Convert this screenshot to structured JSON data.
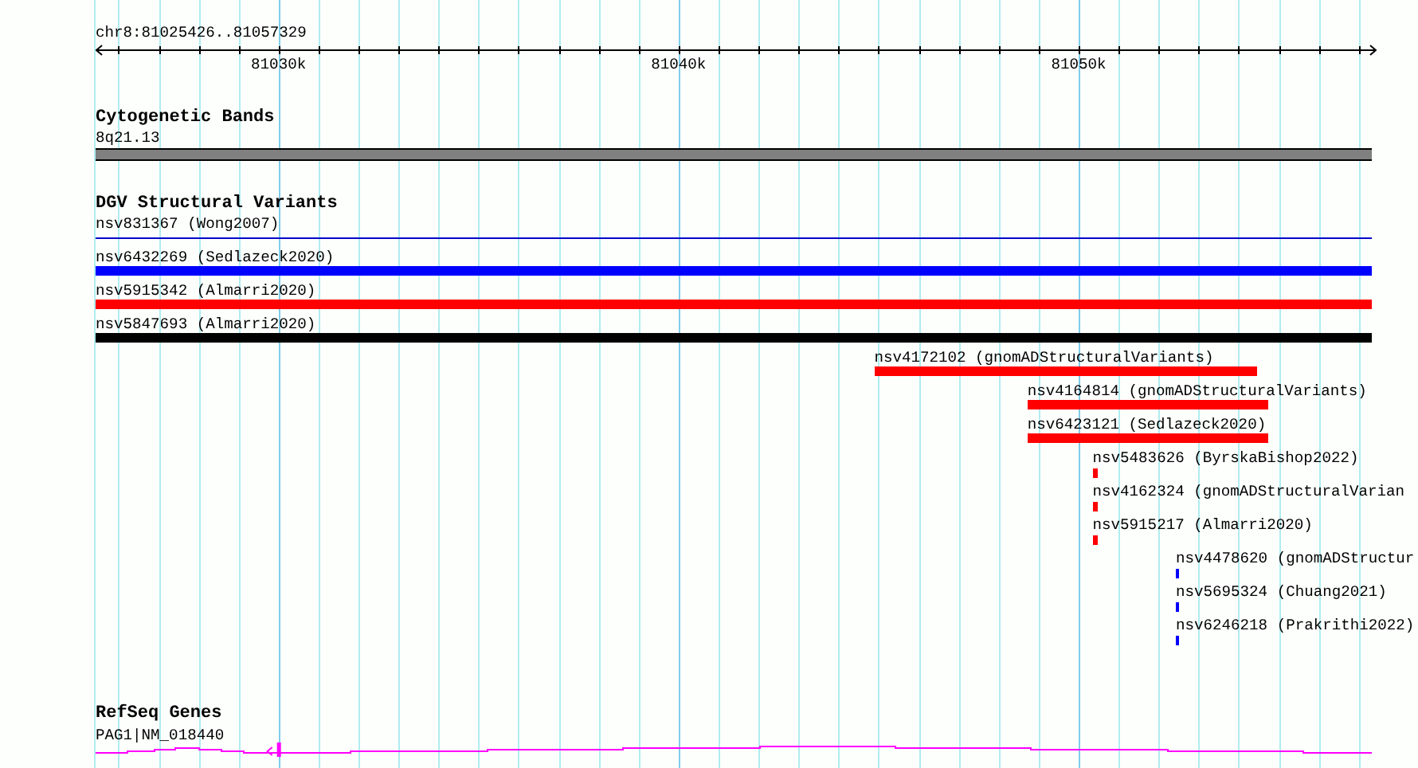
{
  "ruler": {
    "title": "chr8:81025426..81057329",
    "tick_labels": [
      "81030k",
      "81040k",
      "81050k"
    ]
  },
  "tracks": [
    {
      "kind": "cytoband",
      "title": "Cytogenetic Bands",
      "bands": [
        {
          "label": "8q21.13"
        }
      ]
    },
    {
      "kind": "variants",
      "title": "DGV Structural Variants",
      "features": [
        {
          "label": "nsv831367 (Wong2007)",
          "kind": "line",
          "color": "#0000cc"
        },
        {
          "label": "nsv6432269 (Sedlazeck2020)",
          "kind": "bar",
          "color": "#0000ff"
        },
        {
          "label": "nsv5915342 (Almarri2020)",
          "kind": "bar",
          "color": "#ff0000"
        },
        {
          "label": "nsv5847693 (Almarri2020)",
          "kind": "bar",
          "color": "#000000"
        },
        {
          "label": "nsv4172102 (gnomADStructuralVariants)",
          "kind": "bar",
          "color": "#ff0000"
        },
        {
          "label": "nsv4164814 (gnomADStructuralVariants)",
          "kind": "bar",
          "color": "#ff0000"
        },
        {
          "label": "nsv6423121 (Sedlazeck2020)",
          "kind": "bar",
          "color": "#ff0000"
        },
        {
          "label": "nsv5483626 (ByrskaBishop2022)",
          "kind": "bar",
          "color": "#ff0000"
        },
        {
          "label": "nsv4162324 (gnomADStructuralVarian",
          "kind": "bar",
          "color": "#ff0000"
        },
        {
          "label": "nsv5915217 (Almarri2020)",
          "kind": "bar",
          "color": "#ff0000"
        },
        {
          "label": "nsv4478620 (gnomADStructur",
          "kind": "bar",
          "color": "#0000ff"
        },
        {
          "label": "nsv5695324 (Chuang2021)",
          "kind": "bar",
          "color": "#0000ff"
        },
        {
          "label": "nsv6246218 (Prakrithi2022)",
          "kind": "bar",
          "color": "#0000ff"
        }
      ]
    },
    {
      "kind": "genes",
      "title": "RefSeq Genes",
      "genes": [
        {
          "label": "PAG1|NM_018440"
        }
      ]
    }
  ]
}
